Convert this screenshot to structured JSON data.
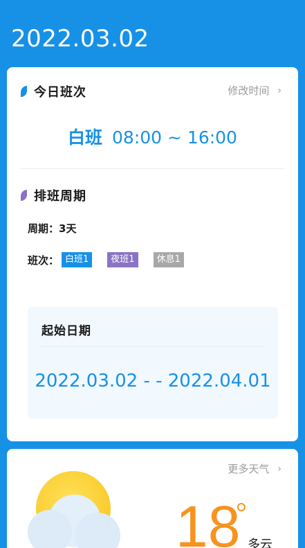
{
  "header": {
    "date": "2022.03.02"
  },
  "today_shift": {
    "title": "今日班次",
    "edit_link": "修改时间",
    "shift_name": "白班",
    "shift_time": "08:00 ~ 16:00"
  },
  "cycle": {
    "title": "排班周期",
    "period_label": "周期：",
    "period_value": "3天",
    "shifts_label": "班次：",
    "tags": [
      "白班1",
      "夜班1",
      "休息1"
    ]
  },
  "start_date": {
    "title": "起始日期",
    "range": "2022.03.02 - - 2022.04.01"
  },
  "weather": {
    "more_link": "更多天气",
    "temperature": "18",
    "condition": "多云"
  },
  "colors": {
    "primary": "#1791e6",
    "purple": "#8a73c4",
    "gray_tag": "#a8a8a8",
    "temp": "#f7931e"
  }
}
